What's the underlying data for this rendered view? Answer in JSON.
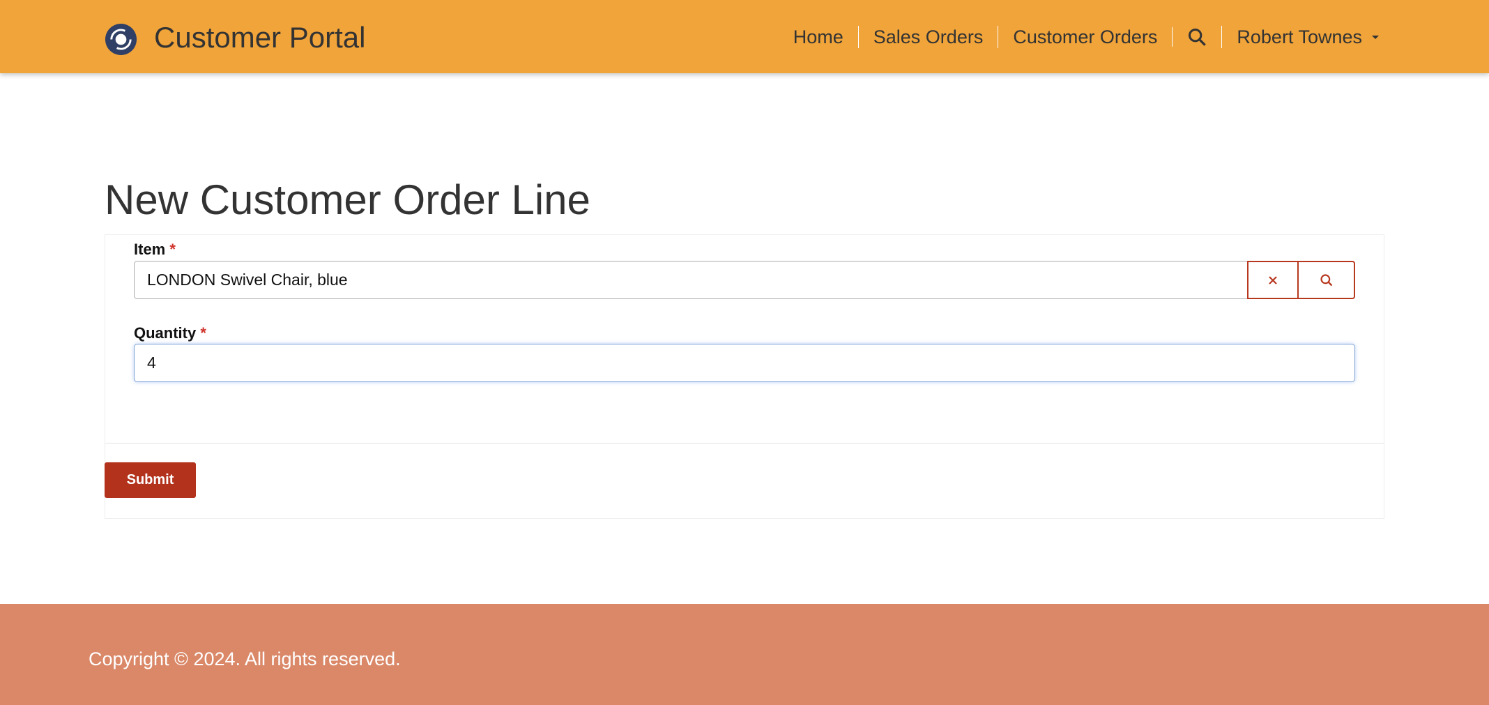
{
  "header": {
    "brand": "Customer Portal",
    "nav": [
      "Home",
      "Sales Orders",
      "Customer Orders"
    ],
    "user": "Robert Townes"
  },
  "page": {
    "title": "New Customer Order Line"
  },
  "form": {
    "item": {
      "label": "Item",
      "required": "*",
      "value": "LONDON Swivel Chair, blue"
    },
    "quantity": {
      "label": "Quantity",
      "required": "*",
      "value": "4"
    },
    "submit": "Submit"
  },
  "footer": {
    "text": "Copyright © 2024. All rights reserved."
  },
  "colors": {
    "header": "#f0a43a",
    "accent": "#b3321c",
    "footer": "#da8868"
  }
}
